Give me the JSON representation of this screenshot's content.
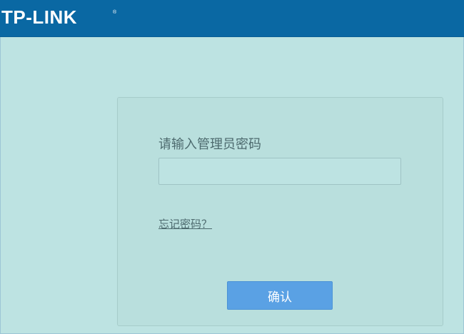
{
  "header": {
    "logo_text": "TP-LINK",
    "logo_mark": "®",
    "background_color": "#0a68a3"
  },
  "login": {
    "prompt": "请输入管理员密码",
    "password_value": "",
    "forgot_password_link": "忘记密码？",
    "confirm_button": "确认"
  },
  "colors": {
    "page_background": "#bde3e2",
    "button": "#5aa1e4",
    "text": "#4d6a6e"
  }
}
